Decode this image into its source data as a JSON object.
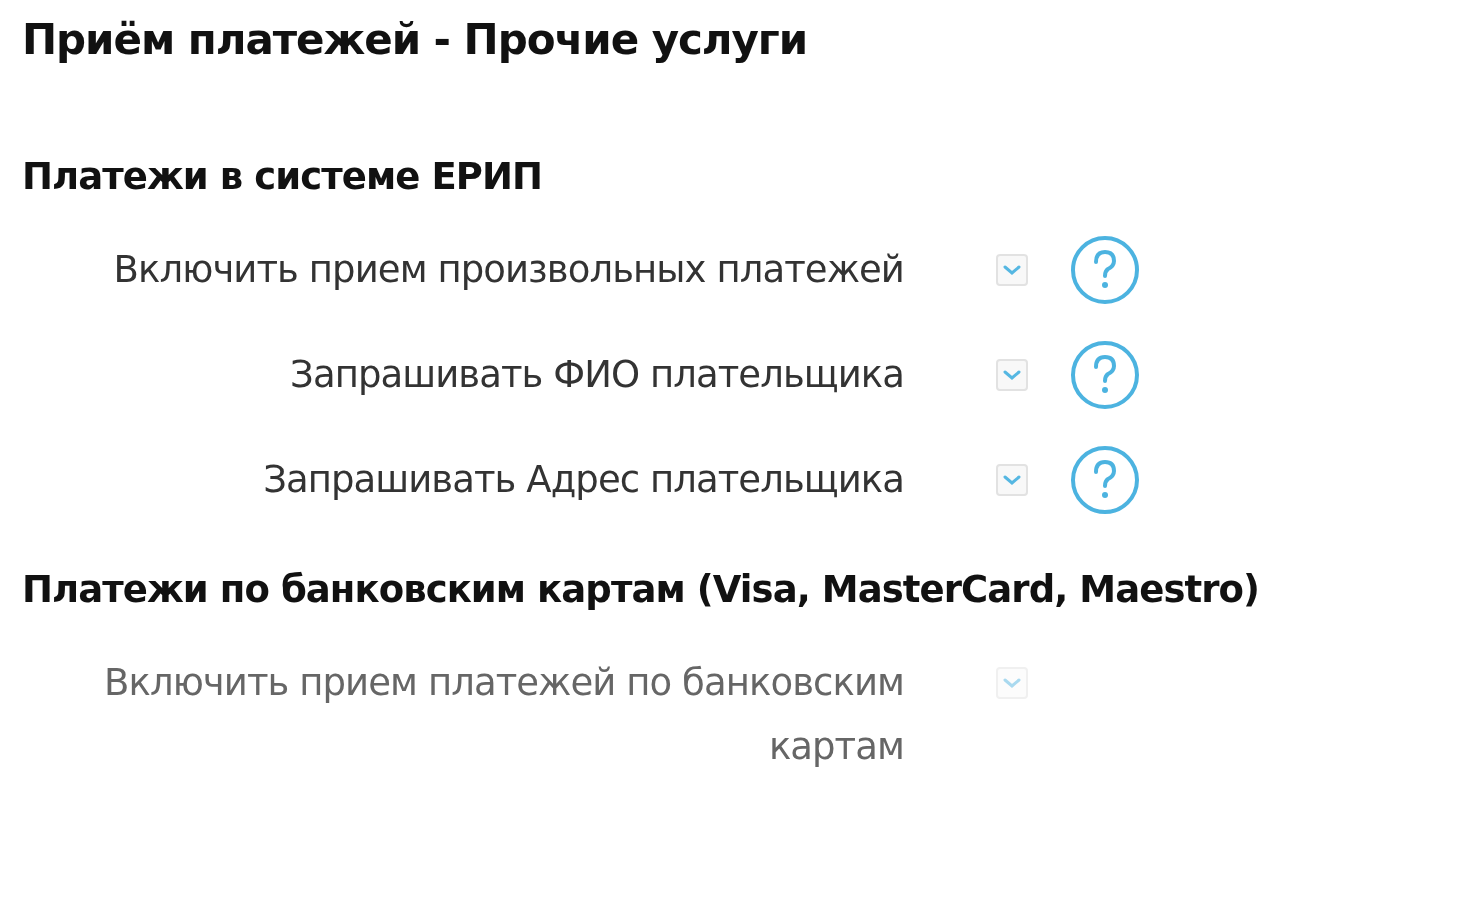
{
  "title": "Приём платежей - Прочие услуги",
  "sections": [
    {
      "heading": "Платежи в системе ЕРИП",
      "options": [
        {
          "label": "Включить прием произвольных платежей",
          "checked": true,
          "disabled": false,
          "help": true
        },
        {
          "label": "Запрашивать ФИО плательщика",
          "checked": true,
          "disabled": false,
          "help": true
        },
        {
          "label": "Запрашивать Адрес плательщика",
          "checked": true,
          "disabled": false,
          "help": true
        }
      ]
    },
    {
      "heading": "Платежи по банковским картам (Visa, MasterCard, Maestro)",
      "options": [
        {
          "label": "Включить прием платежей по банковским картам",
          "checked": true,
          "disabled": true,
          "help": false
        }
      ]
    }
  ]
}
